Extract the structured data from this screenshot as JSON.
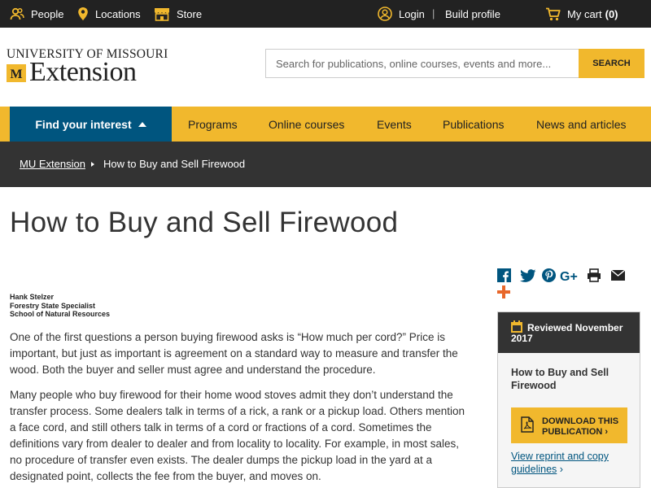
{
  "topbar": {
    "people": "People",
    "locations": "Locations",
    "store": "Store",
    "login": "Login",
    "separator": "|",
    "build_profile": "Build profile",
    "cart_label": "My cart",
    "cart_count": "(0)"
  },
  "header": {
    "logo_line1": "UNIVERSITY OF MISSOURI",
    "logo_line2": "Extension",
    "search_placeholder": "Search for publications, online courses, events and more...",
    "search_button": "SEARCH"
  },
  "nav": {
    "interest": "Find your interest",
    "links": [
      "Programs",
      "Online courses",
      "Events",
      "Publications",
      "News and articles"
    ]
  },
  "breadcrumb": {
    "home": "MU Extension",
    "current": "How to Buy and Sell Firewood"
  },
  "page": {
    "title": "How to Buy and Sell Firewood",
    "author_name": "Hank Stelzer",
    "author_role": "Forestry State Specialist",
    "author_school": "School of Natural Resources",
    "paragraphs": [
      "One of the first questions a person buying firewood asks is “How much per cord?” Price is important, but just as important is agreement on a standard way to measure and transfer the wood. Both the buyer and seller must agree and understand the procedure.",
      "Many people who buy firewood for their home wood stoves admit they don’t understand the transfer process. Some dealers talk in terms of a rick, a rank or a pickup load. Others mention a face cord, and still others talk in terms of a cord or fractions of a cord. Sometimes the definitions vary from dealer to dealer and from locality to locality. For example, in most sales, no procedure of transfer even exists. The dealer dumps the pickup load in the yard at a designated point, collects the fee from the buyer, and moves on."
    ]
  },
  "sidebar": {
    "reviewed_line1": "Reviewed November",
    "reviewed_line2": "2017",
    "pub_title": "How to Buy and Sell Firewood",
    "download_line1": "DOWNLOAD THIS",
    "download_line2": "PUBLICATION ›",
    "reprint": "View reprint and copy guidelines",
    "reprint_arrow": "›"
  },
  "colors": {
    "gold": "#f1b82d",
    "blue": "#00557f",
    "dark": "#222222",
    "breadcrumb_bg": "#333333"
  },
  "icons": [
    "people-icon",
    "location-pin-icon",
    "store-icon",
    "user-circle-icon",
    "cart-icon",
    "facebook-icon",
    "twitter-icon",
    "pinterest-icon",
    "google-plus-icon",
    "print-icon",
    "email-icon",
    "plus-icon",
    "calendar-icon",
    "pdf-icon"
  ]
}
